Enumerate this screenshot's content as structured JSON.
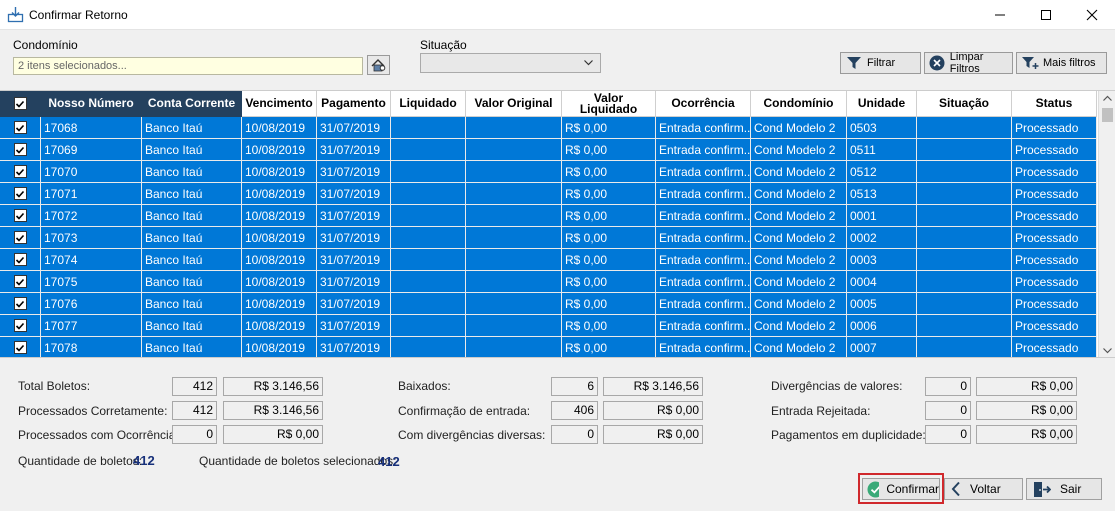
{
  "window": {
    "title": "Confirmar Retorno"
  },
  "filters": {
    "condominio_label": "Condomínio",
    "condominio_value": "2 itens selecionados...",
    "situacao_label": "Situação",
    "situacao_value": "",
    "btn_filtrar": "Filtrar",
    "btn_limpar": "Limpar Filtros",
    "btn_mais": "Mais filtros"
  },
  "grid": {
    "headers": [
      "Nosso Número",
      "Conta Corrente",
      "Vencimento",
      "Pagamento",
      "Liquidado",
      "Valor Original",
      "Valor Liquidado",
      "Ocorrência",
      "Condomínio",
      "Unidade",
      "Situação",
      "Status"
    ],
    "rows": [
      [
        "17068",
        "Banco Itaú",
        "10/08/2019",
        "31/07/2019",
        "",
        "",
        "R$ 0,00",
        "Entrada confirm...",
        "Cond Modelo 2",
        "0503",
        "",
        "Processado"
      ],
      [
        "17069",
        "Banco Itaú",
        "10/08/2019",
        "31/07/2019",
        "",
        "",
        "R$ 0,00",
        "Entrada confirm...",
        "Cond Modelo 2",
        "0511",
        "",
        "Processado"
      ],
      [
        "17070",
        "Banco Itaú",
        "10/08/2019",
        "31/07/2019",
        "",
        "",
        "R$ 0,00",
        "Entrada confirm...",
        "Cond Modelo 2",
        "0512",
        "",
        "Processado"
      ],
      [
        "17071",
        "Banco Itaú",
        "10/08/2019",
        "31/07/2019",
        "",
        "",
        "R$ 0,00",
        "Entrada confirm...",
        "Cond Modelo 2",
        "0513",
        "",
        "Processado"
      ],
      [
        "17072",
        "Banco Itaú",
        "10/08/2019",
        "31/07/2019",
        "",
        "",
        "R$ 0,00",
        "Entrada confirm...",
        "Cond Modelo 2",
        "0001",
        "",
        "Processado"
      ],
      [
        "17073",
        "Banco Itaú",
        "10/08/2019",
        "31/07/2019",
        "",
        "",
        "R$ 0,00",
        "Entrada confirm...",
        "Cond Modelo 2",
        "0002",
        "",
        "Processado"
      ],
      [
        "17074",
        "Banco Itaú",
        "10/08/2019",
        "31/07/2019",
        "",
        "",
        "R$ 0,00",
        "Entrada confirm...",
        "Cond Modelo 2",
        "0003",
        "",
        "Processado"
      ],
      [
        "17075",
        "Banco Itaú",
        "10/08/2019",
        "31/07/2019",
        "",
        "",
        "R$ 0,00",
        "Entrada confirm...",
        "Cond Modelo 2",
        "0004",
        "",
        "Processado"
      ],
      [
        "17076",
        "Banco Itaú",
        "10/08/2019",
        "31/07/2019",
        "",
        "",
        "R$ 0,00",
        "Entrada confirm...",
        "Cond Modelo 2",
        "0005",
        "",
        "Processado"
      ],
      [
        "17077",
        "Banco Itaú",
        "10/08/2019",
        "31/07/2019",
        "",
        "",
        "R$ 0,00",
        "Entrada confirm...",
        "Cond Modelo 2",
        "0006",
        "",
        "Processado"
      ],
      [
        "17078",
        "Banco Itaú",
        "10/08/2019",
        "31/07/2019",
        "",
        "",
        "R$ 0,00",
        "Entrada confirm...",
        "Cond Modelo 2",
        "0007",
        "",
        "Processado"
      ]
    ]
  },
  "summary": {
    "total_boletos": {
      "label": "Total Boletos:",
      "count": "412",
      "value": "R$ 3.146,56"
    },
    "processados_corretamente": {
      "label": "Processados Corretamente:",
      "count": "412",
      "value": "R$ 3.146,56"
    },
    "processados_ocorrencias": {
      "label": "Processados com Ocorrências:",
      "count": "0",
      "value": "R$ 0,00"
    },
    "baixados": {
      "label": "Baixados:",
      "count": "6",
      "value": "R$ 3.146,56"
    },
    "confirmacao_entrada": {
      "label": "Confirmação de entrada:",
      "count": "406",
      "value": "R$ 0,00"
    },
    "divergencias_diversas": {
      "label": "Com divergências diversas:",
      "count": "0",
      "value": "R$ 0,00"
    },
    "divergencias_valores": {
      "label": "Divergências de valores:",
      "count": "0",
      "value": "R$ 0,00"
    },
    "entrada_rejeitada": {
      "label": "Entrada Rejeitada:",
      "count": "0",
      "value": "R$ 0,00"
    },
    "pagamentos_duplicidade": {
      "label": "Pagamentos em duplicidade:",
      "count": "0",
      "value": "R$ 0,00"
    },
    "qtd_boletos_label": "Quantidade de boletos:",
    "qtd_boletos_value": "412",
    "qtd_selecionados_label": "Quantidade de boletos selecionados:",
    "qtd_selecionados_value": "412"
  },
  "actions": {
    "confirmar": "Confirmar",
    "voltar": "Voltar",
    "sair": "Sair"
  },
  "colors": {
    "selection": "#0078d7",
    "header_dark": "#24415f",
    "highlight_border": "#d0282c",
    "confirm_icon": "#3aaa78"
  }
}
